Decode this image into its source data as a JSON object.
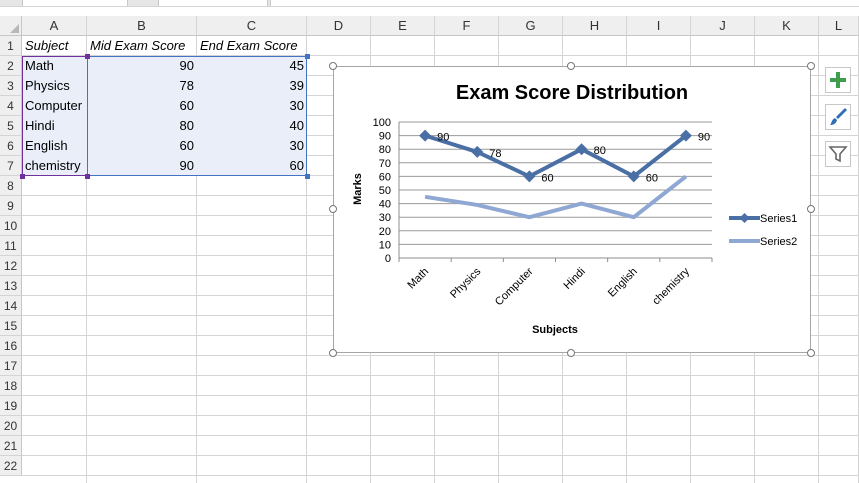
{
  "columns": [
    "A",
    "B",
    "C",
    "D",
    "E",
    "F",
    "G",
    "H",
    "I",
    "J",
    "K",
    "L"
  ],
  "rows": [
    "1",
    "2",
    "3",
    "4",
    "5",
    "6",
    "7",
    "8",
    "9",
    "10",
    "11",
    "12",
    "13",
    "14",
    "15",
    "16",
    "17",
    "18",
    "19",
    "20",
    "21",
    "22"
  ],
  "table": {
    "headers": [
      "Subject",
      "Mid Exam Score",
      "End Exam Score"
    ],
    "data": [
      {
        "subject": "Math",
        "mid": "90",
        "end": "45"
      },
      {
        "subject": "Physics",
        "mid": "78",
        "end": "39"
      },
      {
        "subject": "Computer",
        "mid": "60",
        "end": "30"
      },
      {
        "subject": "Hindi",
        "mid": "80",
        "end": "40"
      },
      {
        "subject": "English",
        "mid": "60",
        "end": "30"
      },
      {
        "subject": "chemistry",
        "mid": "90",
        "end": "60"
      }
    ]
  },
  "chart_data": {
    "type": "line",
    "title": "Exam Score Distribution",
    "xlabel": "Subjects",
    "ylabel": "Marks",
    "categories": [
      "Math",
      "Physics",
      "Computer",
      "Hindi",
      "English",
      "chemistry"
    ],
    "ylim": [
      0,
      100
    ],
    "yticks": [
      "0",
      "10",
      "20",
      "30",
      "40",
      "50",
      "60",
      "70",
      "80",
      "90",
      "100"
    ],
    "grid": true,
    "legend_position": "right",
    "series": [
      {
        "name": "Series1",
        "values": [
          90,
          78,
          60,
          80,
          60,
          90
        ],
        "labels": [
          "90",
          "78",
          "60",
          "80",
          "60",
          "90"
        ],
        "color": "#4a6fa5",
        "marker": "diamond"
      },
      {
        "name": "Series2",
        "values": [
          45,
          39,
          30,
          40,
          30,
          60
        ],
        "color": "#8fa8d3",
        "marker": "none"
      }
    ]
  },
  "side_tools": [
    {
      "icon": "plus-icon",
      "color": "#3e9e4e"
    },
    {
      "icon": "brush-icon",
      "color": "#2f6db5"
    },
    {
      "icon": "filter-icon",
      "color": "#666666"
    }
  ]
}
